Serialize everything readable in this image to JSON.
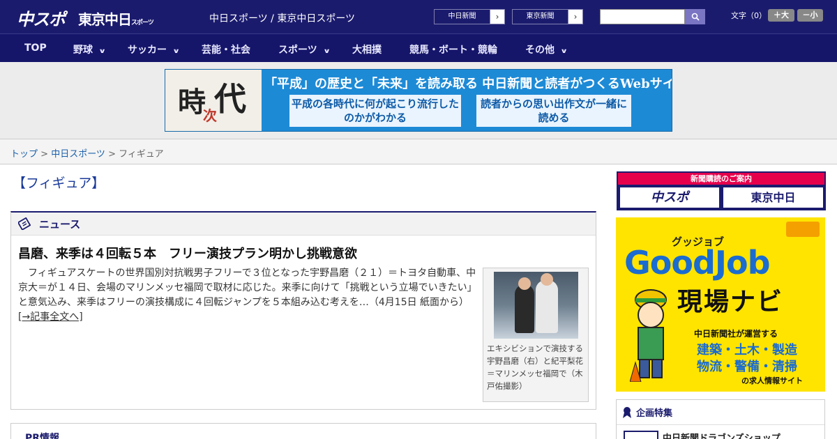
{
  "header": {
    "logo_chuspo": "中スポ",
    "logo_tokyo": "東京中日",
    "logo_tokyo_small": "スポーツ",
    "site_names": "中日スポーツ / 東京中日スポーツ",
    "links": [
      {
        "label": "中日新聞",
        "arrow": "›"
      },
      {
        "label": "東京新聞",
        "arrow": "›"
      }
    ],
    "search": {
      "placeholder": "",
      "button_icon": "search-icon"
    },
    "font_size_label": "文字（0）",
    "font_larger": "＋大",
    "font_smaller": "－小"
  },
  "nav": {
    "items": [
      {
        "label": "TOP",
        "dropdown": false
      },
      {
        "label": "野球",
        "dropdown": true
      },
      {
        "label": "サッカー",
        "dropdown": true
      },
      {
        "label": "芸能・社会",
        "dropdown": false
      },
      {
        "label": "スポーツ",
        "dropdown": true
      },
      {
        "label": "大相撲",
        "dropdown": false
      },
      {
        "label": "競馬・ボート・競輪",
        "dropdown": false
      },
      {
        "label": "その他",
        "dropdown": true
      }
    ],
    "chevron": "∨"
  },
  "banner": {
    "kanji1": "時",
    "kanji2": "代",
    "kanji3": "次",
    "headline": "「平成」の歴史と「未来」を読み取る 中日新聞と読者がつくるWebサイト",
    "box1": "平成の各時代に何が起こり流行したのかがわかる",
    "box2": "読者からの思い出作文が一緒に読める"
  },
  "breadcrumb": {
    "home": "トップ",
    "sep1": " > ",
    "section": "中日スポーツ",
    "sep2": " > ",
    "current": "フィギュア"
  },
  "page": {
    "title": "【フィギュア】"
  },
  "news": {
    "heading": "ニュース",
    "article": {
      "title": "昌磨、来季は４回転５本　フリー演技プラン明かし挑戦意欲",
      "body": "フィギュアスケートの世界国別対抗戦男子フリーで３位となった宇野昌磨（２１）＝トヨタ自動車、中京大＝が１４日、会場のマリンメッセ福岡で取材に応じた。来季に向けて「挑戦という立場でいきたい」と意気込み、来季はフリーの演技構成に４回転ジャンプを５本組み込む考えを…（4月15日 紙面から）",
      "more_link": "[→記事全文へ]",
      "caption": "エキシビションで演技する宇野昌磨（右）と紀平梨花＝マリンメッセ福岡で（木戸佑撮影）"
    }
  },
  "pr": {
    "heading": "PR情報"
  },
  "sidebar": {
    "subscribe_label": "新聞購読のご案内",
    "subscribe_chuspo": "中スポ",
    "subscribe_tokyo": "東京中日",
    "goodjob": {
      "kana": "グッジョブ",
      "title": "GoodJob",
      "subtitle": "現場ナビ",
      "line1": "中日新聞社が運営する",
      "line2": "建築・土木・製造",
      "line3": "物流・警備・清掃",
      "line4": "の求人情報サイト"
    },
    "feature": {
      "heading": "企画特集",
      "item": "中日新聞ドラゴンズショップ"
    }
  },
  "colors": {
    "header_bg": "#1b1b6e",
    "nav_bg": "#15156a",
    "accent_red": "#e6004c",
    "goodjob_yellow": "#ffe400",
    "goodjob_blue": "#1a6cd0"
  }
}
